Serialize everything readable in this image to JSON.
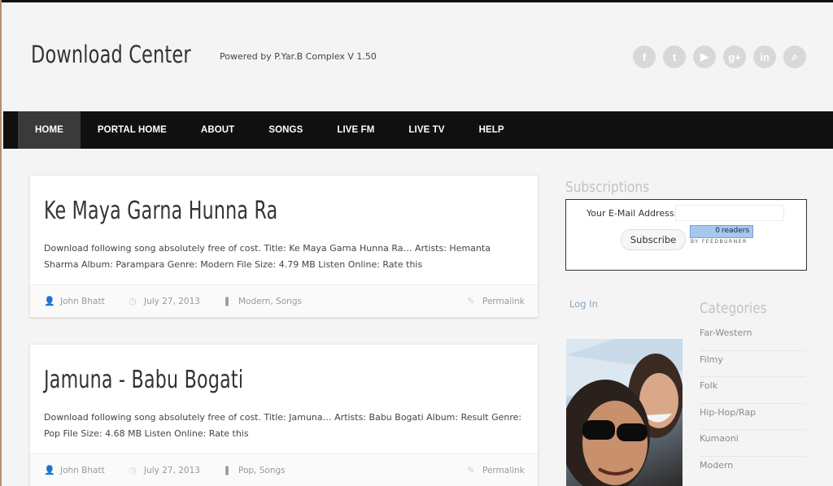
{
  "header": {
    "site_title": "Download Center",
    "tagline": "Powered by P.Yar.B Complex V 1.50",
    "social": [
      {
        "icon": "facebook-icon",
        "glyph": "f"
      },
      {
        "icon": "twitter-icon",
        "glyph": "t"
      },
      {
        "icon": "youtube-icon",
        "glyph": "▶"
      },
      {
        "icon": "google-plus-icon",
        "glyph": "g+"
      },
      {
        "icon": "linkedin-icon",
        "glyph": "in"
      },
      {
        "icon": "search-icon",
        "glyph": "⌕"
      }
    ]
  },
  "nav": [
    "HOME",
    "PORTAL HOME",
    "ABOUT",
    "SONGS",
    "LIVE FM",
    "LIVE TV",
    "HELP"
  ],
  "posts": [
    {
      "title": "Ke Maya Garna Hunna Ra",
      "excerpt": "Download following song absolutely free of cost. Title: Ke Maya Garna Hunna Ra… Artists: Hemanta Sharma Album: Parampara Genre: Modern File Size: 4.79 MB Listen Online: Rate this",
      "author": "John Bhatt",
      "date": "July 27, 2013",
      "cat1": "Modern",
      "cat2": "Songs",
      "permalink": "Permalink"
    },
    {
      "title": "Jamuna - Babu Bogati",
      "excerpt": "Download following song absolutely free of cost. Title: Jamuna… Artists: Babu Bogati Album: Result Genre: Pop File Size: 4.68 MB Listen Online: Rate this",
      "author": "John Bhatt",
      "date": "July 27, 2013",
      "cat1": "Pop",
      "cat2": "Songs",
      "permalink": "Permalink"
    }
  ],
  "sidebar": {
    "subscriptions_title": "Subscriptions",
    "email_label": "Your E-Mail Address:",
    "email_value": "",
    "subscribe_button": "Subscribe",
    "feed_count": "0",
    "feed_label": "readers",
    "feed_by": "BY FEEDBURNER",
    "login": "Log In",
    "categories_title": "Categories",
    "categories": [
      "Far-Western",
      "Filmy",
      "Folk",
      "Hip-Hop/Rap",
      "Kumaoni",
      "Modern"
    ]
  }
}
